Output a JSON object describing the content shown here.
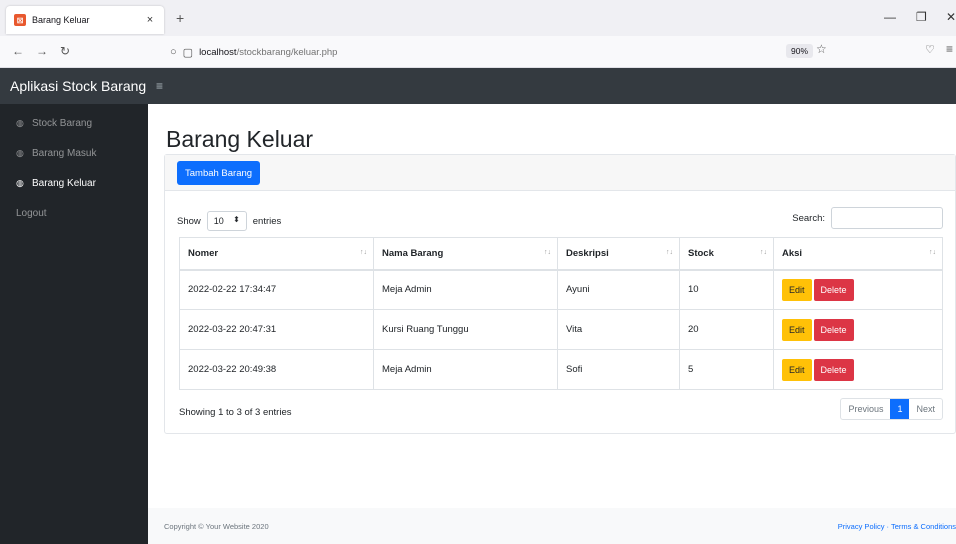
{
  "browser": {
    "tab_title": "Barang Keluar",
    "tab_close": "×",
    "new_tab": "+",
    "url_host": "localhost",
    "url_path": "/stockbarang/keluar.php",
    "zoom": "90%"
  },
  "app": {
    "brand": "Aplikasi Stock Barang",
    "toggle": "≡"
  },
  "sidebar": {
    "items": [
      {
        "label": "Stock Barang"
      },
      {
        "label": "Barang Masuk"
      },
      {
        "label": "Barang Keluar"
      },
      {
        "label": "Logout"
      }
    ]
  },
  "main": {
    "title": "Barang Keluar",
    "add_button": "Tambah Barang",
    "show_label": "Show",
    "entries_value": "10",
    "entries_label": "entries",
    "search_label": "Search:",
    "columns": [
      "Nomer",
      "Nama Barang",
      "Deskripsi",
      "Stock",
      "Aksi"
    ],
    "rows": [
      [
        "2022-02-22 17:34:47",
        "Meja Admin",
        "Ayuni",
        "10"
      ],
      [
        "2022-03-22 20:47:31",
        "Kursi Ruang Tunggu",
        "Vita",
        "20"
      ],
      [
        "2022-03-22 20:49:38",
        "Meja Admin",
        "Sofi",
        "5"
      ]
    ],
    "edit_label": "Edit",
    "delete_label": "Delete",
    "info": "Showing 1 to 3 of 3 entries",
    "pager": {
      "previous": "Previous",
      "current": "1",
      "next": "Next"
    }
  },
  "footer": {
    "copyright": "Copyright © Your Website 2020",
    "links": "Privacy Policy · Terms & Conditions"
  },
  "colors": {
    "primary": "#0d6efd",
    "warning": "#ffc107",
    "danger": "#dc3545",
    "sidebar": "#212529",
    "topnav": "#343a40"
  }
}
